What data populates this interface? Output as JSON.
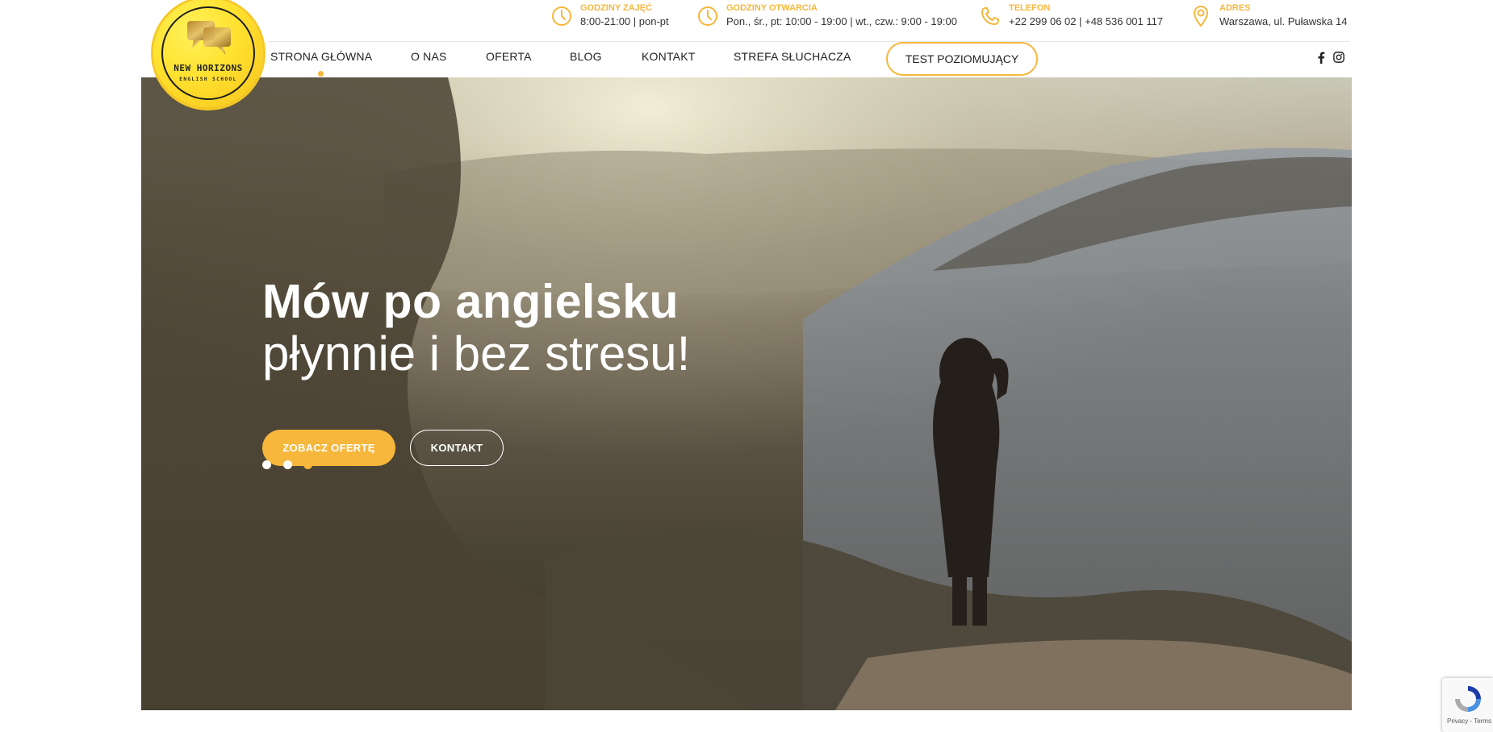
{
  "logo": {
    "name": "NEW HORIZONS",
    "sub": "ENGLISH SCHOOL"
  },
  "info": [
    {
      "label": "GODZINY ZAJĘĆ",
      "value": "8:00-21:00 | pon-pt",
      "icon": "clock-icon"
    },
    {
      "label": "GODZINY OTWARCIA",
      "value": "Pon., śr., pt: 10:00 - 19:00 | wt., czw.: 9:00 - 19:00",
      "icon": "clock-icon"
    },
    {
      "label": "TELEFON",
      "value": "+22 299 06 02 | +48 536 001 117",
      "icon": "phone-icon"
    },
    {
      "label": "ADRES",
      "value": "Warszawa, ul. Puławska 14",
      "icon": "location-pin-icon"
    }
  ],
  "nav": {
    "items": [
      "STRONA GŁÓWNA",
      "O NAS",
      "OFERTA",
      "BLOG",
      "KONTAKT",
      "STREFA SŁUCHACZA"
    ],
    "active": "STRONA GŁÓWNA",
    "cta": "TEST POZIOMUJĄCY",
    "social": [
      "facebook-icon",
      "instagram-icon"
    ]
  },
  "hero": {
    "title": "Mów po angielsku",
    "subtitle": "płynnie i bez stresu!",
    "primary_button": "ZOBACZ OFERTĘ",
    "secondary_button": "KONTAKT",
    "slides": 3,
    "active_slide": 3
  },
  "recaptcha": {
    "text": "Privacy - Terms"
  },
  "colors": {
    "accent": "#f6b73c",
    "text": "#222222"
  }
}
